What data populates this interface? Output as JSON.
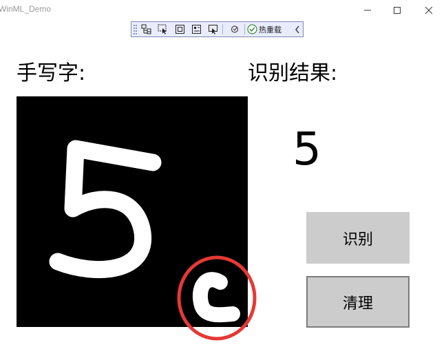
{
  "window": {
    "title": "WinML_Demo"
  },
  "debug_toolbar": {
    "hot_reload_label": "热重载",
    "icons": [
      "live-visual-tree-icon",
      "select-element-icon",
      "display-layout-adorners-icon",
      "track-focus-icon",
      "binding-failures-icon",
      "hot-reload-status-icon"
    ]
  },
  "main": {
    "handwriting_label": "手写字:",
    "result_label": "识别结果:",
    "result_value": "5",
    "recognize_button": "识别",
    "clear_button": "清理"
  },
  "colors": {
    "canvas_background": "#000000",
    "ink": "#ffffff",
    "annotation_circle": "#e53935",
    "button_background": "#cccccc",
    "toolbar_background": "#e9ecfa"
  }
}
